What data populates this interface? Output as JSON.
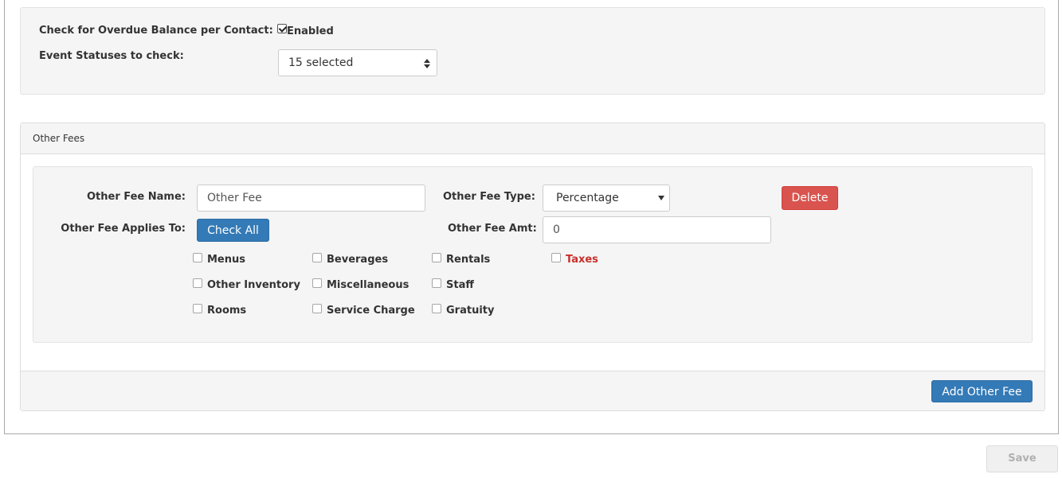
{
  "overdue": {
    "check_label": "Check for Overdue Balance per Contact:",
    "enabled_checked": true,
    "enabled_label": "Enabled",
    "statuses_label": "Event Statuses to check:",
    "statuses_value": "15 selected"
  },
  "other_fees": {
    "heading": "Other Fees",
    "name_label": "Other Fee Name:",
    "name_value": "Other Fee",
    "type_label": "Other Fee Type:",
    "type_value": "Percentage",
    "delete_label": "Delete",
    "applies_label": "Other Fee Applies To:",
    "check_all_label": "Check All",
    "amt_label": "Other Fee Amt:",
    "amt_value": "0",
    "categories": [
      {
        "label": "Menus",
        "checked": false
      },
      {
        "label": "Beverages",
        "checked": false
      },
      {
        "label": "Rentals",
        "checked": false
      },
      {
        "label": "Taxes",
        "checked": false
      },
      {
        "label": "Other Inventory",
        "checked": false
      },
      {
        "label": "Miscellaneous",
        "checked": false
      },
      {
        "label": "Staff",
        "checked": false
      },
      {
        "label": "Rooms",
        "checked": false
      },
      {
        "label": "Service Charge",
        "checked": false
      },
      {
        "label": "Gratuity",
        "checked": false
      }
    ],
    "taxes_color": "#c9302c",
    "add_label": "Add Other Fee"
  },
  "save_label": "Save",
  "icons": {
    "select_arrows": "sort-icon",
    "dropdown_caret": "caret-down-icon"
  }
}
